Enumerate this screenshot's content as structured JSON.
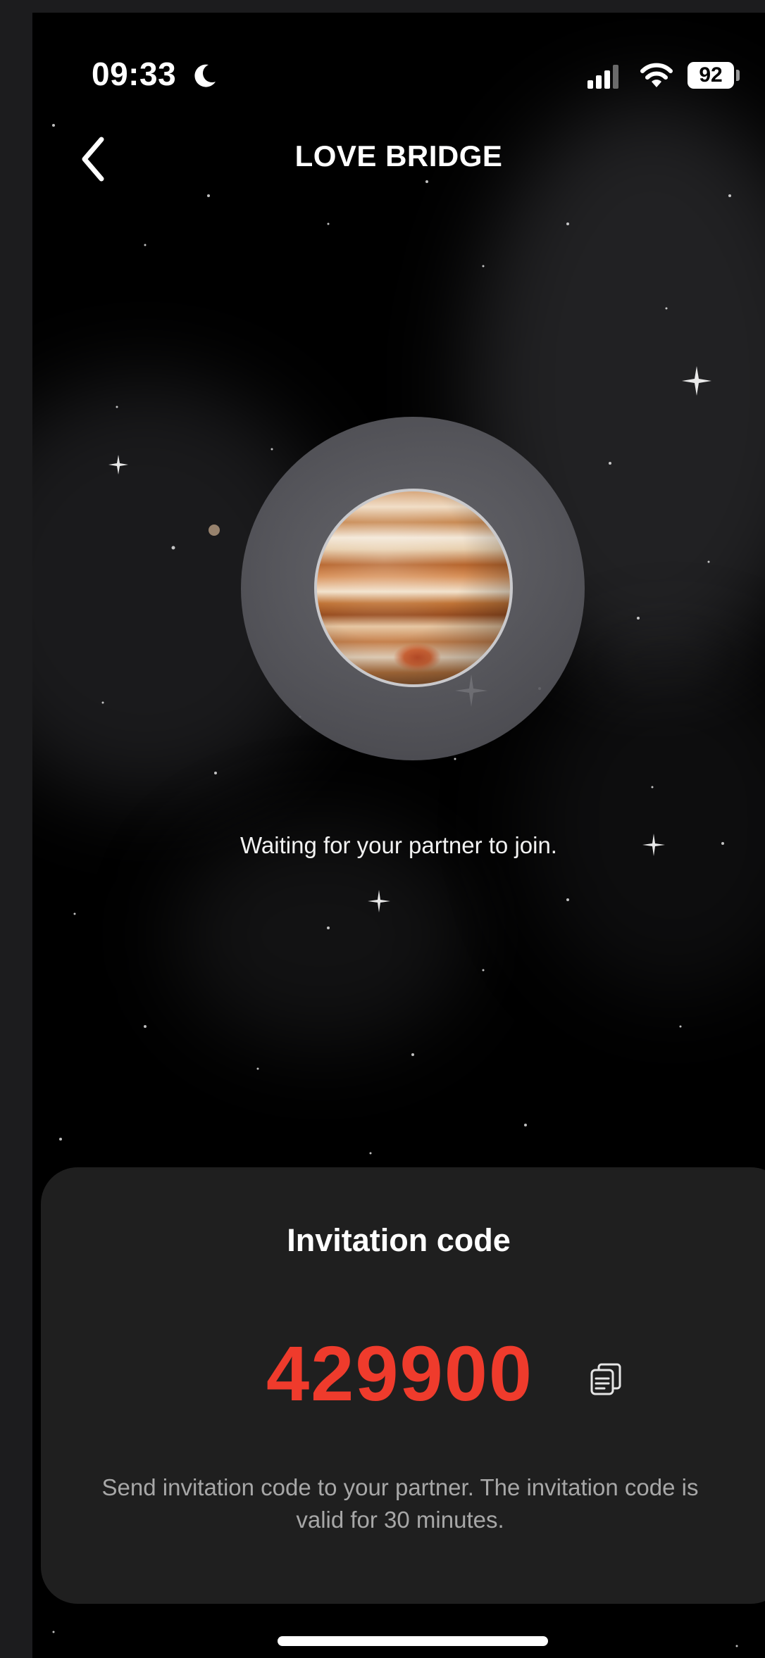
{
  "status_bar": {
    "time": "09:33",
    "battery": "92",
    "icons": [
      "moon-icon",
      "signal-icon",
      "wifi-icon",
      "battery-icon"
    ]
  },
  "header": {
    "title": "LOVE BRIDGE",
    "back_icon": "chevron-left-icon"
  },
  "main": {
    "planet_image": "jupiter-planet",
    "waiting_text": "Waiting for your partner to join."
  },
  "invitation": {
    "title": "Invitation code",
    "code": "429900",
    "copy_icon": "copy-icon",
    "description": "Send invitation code to your partner. The invitation code is valid for 30 minutes."
  },
  "colors": {
    "background": "#000000",
    "card": "#1f1f1f",
    "code": "#ef3b2c",
    "text": "#ffffff",
    "muted_text": "#a7a7a7"
  }
}
